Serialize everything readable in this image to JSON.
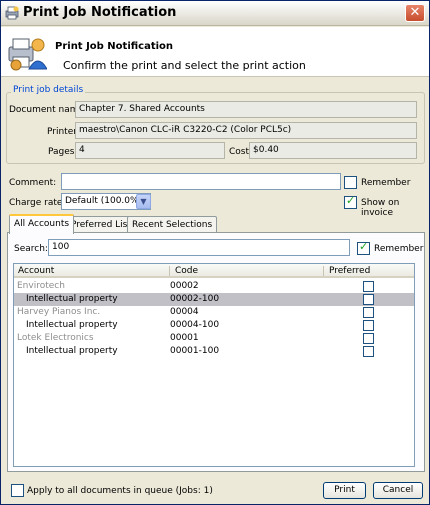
{
  "window": {
    "title": "Print Job Notification"
  },
  "header": {
    "title": "Print Job Notification",
    "subtitle": "Confirm the print and select the print action"
  },
  "details": {
    "legend": "Print job details",
    "document_name_label": "Document name",
    "document_name": "Chapter 7. Shared Accounts",
    "printer_label": "Printer",
    "printer": "maestro\\Canon CLC-iR C3220-C2 (Color PCL5c)",
    "pages_label": "Pages",
    "pages": "4",
    "cost_label": "Cost",
    "cost": "$0.40"
  },
  "comment": {
    "label": "Comment:",
    "value": "",
    "remember_label": "Remember",
    "remember_checked": false
  },
  "charge": {
    "label": "Charge rate:",
    "value": "Default (100.0%)",
    "show_on_invoice_label": "Show on invoice",
    "show_on_invoice_checked": true
  },
  "tabs": [
    {
      "label": "All Accounts",
      "active": true
    },
    {
      "label": "Preferred List",
      "active": false
    },
    {
      "label": "Recent Selections",
      "active": false
    }
  ],
  "search": {
    "label": "Search:",
    "value": "100",
    "remember_label": "Remember",
    "remember_checked": true
  },
  "table": {
    "columns": [
      "Account",
      "Code",
      "Preferred"
    ],
    "rows": [
      {
        "account": "Envirotech",
        "code": "00002",
        "parent": true,
        "selected": false
      },
      {
        "account": "Intellectual property",
        "code": "00002-100",
        "parent": false,
        "selected": true
      },
      {
        "account": "Harvey Pianos Inc.",
        "code": "00004",
        "parent": true,
        "selected": false
      },
      {
        "account": "Intellectual property",
        "code": "00004-100",
        "parent": false,
        "selected": false
      },
      {
        "account": "Lotek Electronics",
        "code": "00001",
        "parent": true,
        "selected": false
      },
      {
        "account": "Intellectual property",
        "code": "00001-100",
        "parent": false,
        "selected": false
      }
    ]
  },
  "footer": {
    "apply_all_label": "Apply to all documents in queue (Jobs: 1)",
    "apply_all_checked": false,
    "print_label": "Print",
    "cancel_label": "Cancel"
  },
  "colors": {
    "legend": "#0046d5",
    "parent_account_text": "#8e8e8e",
    "selected_row": "#c1c0c6",
    "window_bg": "#ece9d8",
    "checkmark": "#21a121"
  }
}
